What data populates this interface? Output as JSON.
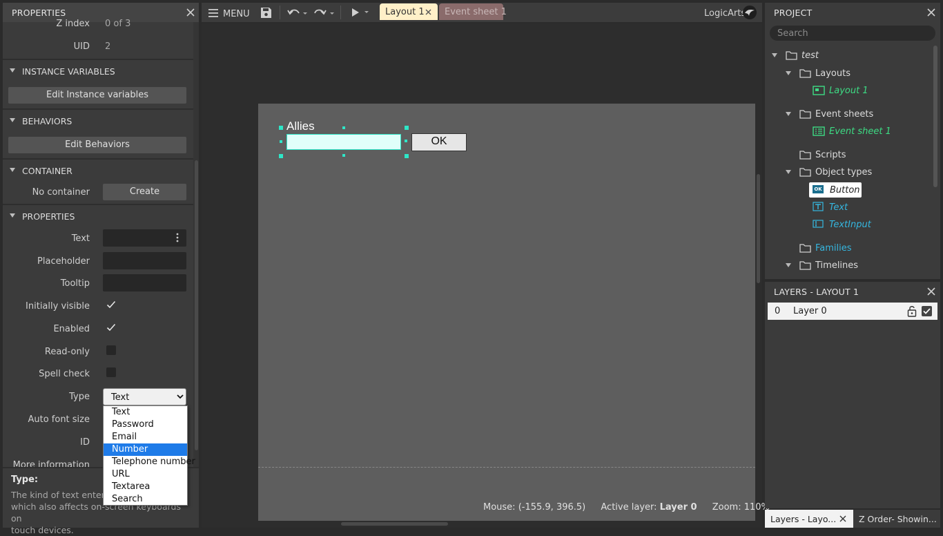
{
  "properties_panel": {
    "title": "PROPERTIES",
    "top_rows": [
      {
        "label": "Z index",
        "value": "0 of 3"
      },
      {
        "label": "UID",
        "value": "2"
      }
    ],
    "instance_variables": {
      "header": "INSTANCE VARIABLES",
      "button": "Edit Instance variables"
    },
    "behaviors": {
      "header": "BEHAVIORS",
      "button": "Edit Behaviors"
    },
    "container": {
      "header": "CONTAINER",
      "label": "No container",
      "button": "Create"
    },
    "properties": {
      "header": "PROPERTIES",
      "text_label": "Text",
      "placeholder_label": "Placeholder",
      "tooltip_label": "Tooltip",
      "initially_visible_label": "Initially visible",
      "initially_visible": true,
      "enabled_label": "Enabled",
      "enabled": true,
      "readonly_label": "Read-only",
      "readonly": false,
      "spellcheck_label": "Spell check",
      "spellcheck": false,
      "type_label": "Type",
      "type_value": "Text",
      "autofont_label": "Auto font size",
      "id_label": "ID",
      "more_label": "More information"
    },
    "type_options": [
      "Text",
      "Password",
      "Email",
      "Number",
      "Telephone number",
      "URL",
      "Textarea",
      "Search"
    ],
    "type_highlighted": "Number",
    "help": {
      "title": "Type:",
      "line1": "The kind of text entered",
      "line2": "which also affects on-screen keyboards on",
      "line3": "touch devices."
    }
  },
  "toolbar": {
    "menu_label": "MENU",
    "tabs": [
      {
        "label": "Layout 1",
        "active": true
      },
      {
        "label": "Event sheet 1",
        "active": false
      }
    ],
    "brand": "LogicArts"
  },
  "layout_view": {
    "text_object": "Allies",
    "button_object": "OK",
    "status": {
      "mouse_prefix": "Mouse: ",
      "mouse_value": "(-155.9, 396.5)",
      "layer_prefix": "Active layer: ",
      "layer_value": "Layer 0",
      "zoom_prefix": "Zoom: ",
      "zoom_value": "110%"
    }
  },
  "project_panel": {
    "title": "PROJECT",
    "search_placeholder": "Search",
    "root": "test",
    "layouts_folder": "Layouts",
    "layout_item": "Layout 1",
    "eventsheets_folder": "Event sheets",
    "eventsheet_item": "Event sheet 1",
    "scripts_folder": "Scripts",
    "objecttypes_folder": "Object types",
    "object_button": "Button",
    "object_text": "Text",
    "object_textinput": "TextInput",
    "button_icon_text": "OK",
    "families_folder": "Families",
    "timelines_folder": "Timelines"
  },
  "layers_panel": {
    "title": "LAYERS - LAYOUT 1",
    "layer_index": "0",
    "layer_name": "Layer 0"
  },
  "bottom_tabs": {
    "tab1": "Layers - Layo...",
    "tab2": "Z Order- Showin..."
  },
  "colors": {
    "accent_green": "#3ddc84",
    "accent_cyan": "#35b7e0",
    "selection_handle": "#2ee6c7",
    "dropdown_highlight": "#1e7be8"
  }
}
